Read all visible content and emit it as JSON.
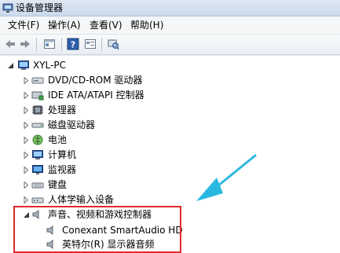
{
  "window": {
    "title": "设备管理器"
  },
  "menu": [
    {
      "label": "文件(F)"
    },
    {
      "label": "操作(A)"
    },
    {
      "label": "查看(V)"
    },
    {
      "label": "帮助(H)"
    }
  ],
  "toolbar": {
    "icons": [
      "back-icon",
      "forward-icon",
      "properties-icon",
      "help-icon",
      "view-icon",
      "scan-hardware-icon"
    ]
  },
  "tree": {
    "root": "XYL-PC",
    "items": [
      {
        "label": "DVD/CD-ROM 驱动器",
        "icon": "dvd-drive-icon"
      },
      {
        "label": "IDE ATA/ATAPI 控制器",
        "icon": "ide-controller-icon"
      },
      {
        "label": "处理器",
        "icon": "processor-icon"
      },
      {
        "label": "磁盘驱动器",
        "icon": "disk-drive-icon"
      },
      {
        "label": "电池",
        "icon": "battery-icon"
      },
      {
        "label": "计算机",
        "icon": "computer-icon"
      },
      {
        "label": "监视器",
        "icon": "monitor-icon"
      },
      {
        "label": "键盘",
        "icon": "keyboard-icon"
      },
      {
        "label": "人体学输入设备",
        "icon": "hid-icon"
      },
      {
        "label": "声音、视频和游戏控制器",
        "icon": "sound-icon",
        "expanded": true
      }
    ],
    "children": [
      {
        "label": "Conexant SmartAudio HD",
        "icon": "speaker-icon"
      },
      {
        "label": "英特尔(R) 显示器音频",
        "icon": "speaker-icon"
      }
    ]
  },
  "colors": {
    "highlight": "#e02a2a",
    "arrow": "#2bb8e0"
  }
}
